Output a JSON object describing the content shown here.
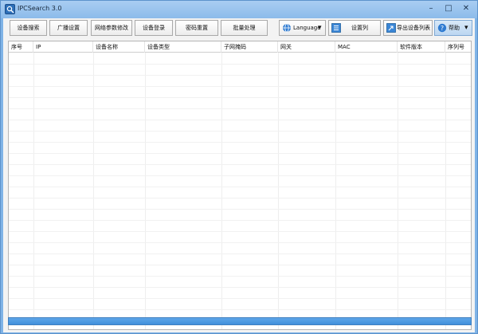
{
  "window": {
    "title": "IPCSearch 3.0",
    "min_glyph": "–",
    "max_glyph": "□",
    "close_glyph": "✕"
  },
  "toolbar": {
    "search_devices": "设备搜索",
    "broadcast_settings": "广播设置",
    "network_params": "网络参数修改",
    "device_login": "设备登录",
    "password_reset": "密码重置",
    "batch_process": "批量处理",
    "language": "Language",
    "language_caret": "▾",
    "set_columns": "设置列",
    "export_list": "导出设备列表",
    "help": "帮助",
    "help_caret": "▾"
  },
  "table": {
    "columns": [
      "序号",
      "IP",
      "设备名称",
      "设备类型",
      "子网掩码",
      "网关",
      "MAC",
      "软件版本",
      "序列号"
    ]
  },
  "colors": {
    "accent": "#3f8fdb",
    "titlebar": "#a9cdf2"
  }
}
